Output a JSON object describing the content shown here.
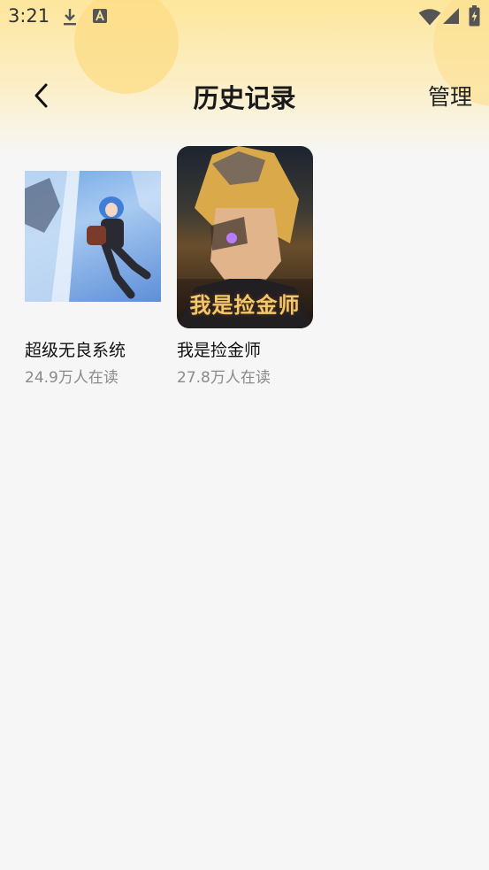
{
  "status_bar": {
    "time": "3:21",
    "icons": [
      "download-icon",
      "a-notification-icon",
      "wifi-icon",
      "signal-icon",
      "battery-icon"
    ]
  },
  "header": {
    "title": "历史记录",
    "manage_label": "管理",
    "back_icon": "chevron-left-icon"
  },
  "books": [
    {
      "title": "超级无良系统",
      "readers": "24.9万人在读"
    },
    {
      "title": "我是捡金师",
      "readers": "27.8万人在读",
      "cover_text": "我是捡金师"
    }
  ],
  "colors": {
    "header_gradient_top": "#fde69c",
    "page_background": "#f6f6f6",
    "secondary_text": "#8a8a8a"
  }
}
